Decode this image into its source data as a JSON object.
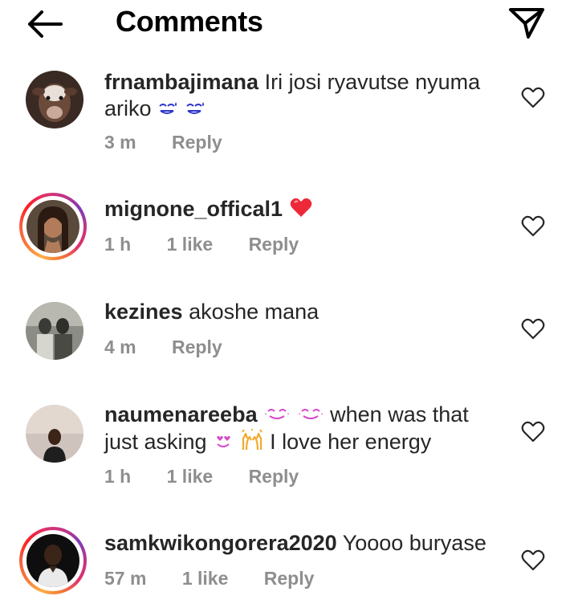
{
  "header": {
    "title": "Comments",
    "back_icon": "arrow-left-icon",
    "share_icon": "paper-plane-icon"
  },
  "comments": [
    {
      "username": "frnambajimana",
      "text": "Iri josi ryavutse nyuma ariko",
      "emojis": [
        "sweat-smile-emoji",
        "sweat-smile-emoji"
      ],
      "time": "3 m",
      "likes": "",
      "reply_label": "Reply",
      "avatar": "cow-photo",
      "story_ring": false
    },
    {
      "username": "mignone_offical1",
      "text": "",
      "emojis": [
        "red-heart-emoji"
      ],
      "time": "1 h",
      "likes": "1 like",
      "reply_label": "Reply",
      "avatar": "woman-portrait",
      "story_ring": true
    },
    {
      "username": "kezines",
      "text": "akoshe mana",
      "emojis": [],
      "time": "4 m",
      "likes": "",
      "reply_label": "Reply",
      "avatar": "vintage-couple-photo",
      "story_ring": false
    },
    {
      "username": "naumenareeba",
      "text_after_emojis": "when was that just asking",
      "text_end": "I love her energy",
      "emojis": [
        "smiling-face-with-hearts-emoji",
        "smiling-face-with-hearts-emoji"
      ],
      "emojis_mid": [
        "heart-eyes-emoji",
        "raising-hands-emoji"
      ],
      "time": "1 h",
      "likes": "1 like",
      "reply_label": "Reply",
      "avatar": "woman-selfie",
      "story_ring": false
    },
    {
      "username": "samkwikongorera2020",
      "text": "Yoooo buryase",
      "emojis": [],
      "time": "57 m",
      "likes": "1 like",
      "reply_label": "Reply",
      "avatar": "man-portrait",
      "story_ring": true
    }
  ],
  "colors": {
    "meta_gray": "#8e8e8e",
    "text": "#262626",
    "heart_red": "#ed2939",
    "emoji_blue": "#2b35c9",
    "emoji_pink": "#d548c9",
    "emoji_yellow": "#f4a92a"
  }
}
